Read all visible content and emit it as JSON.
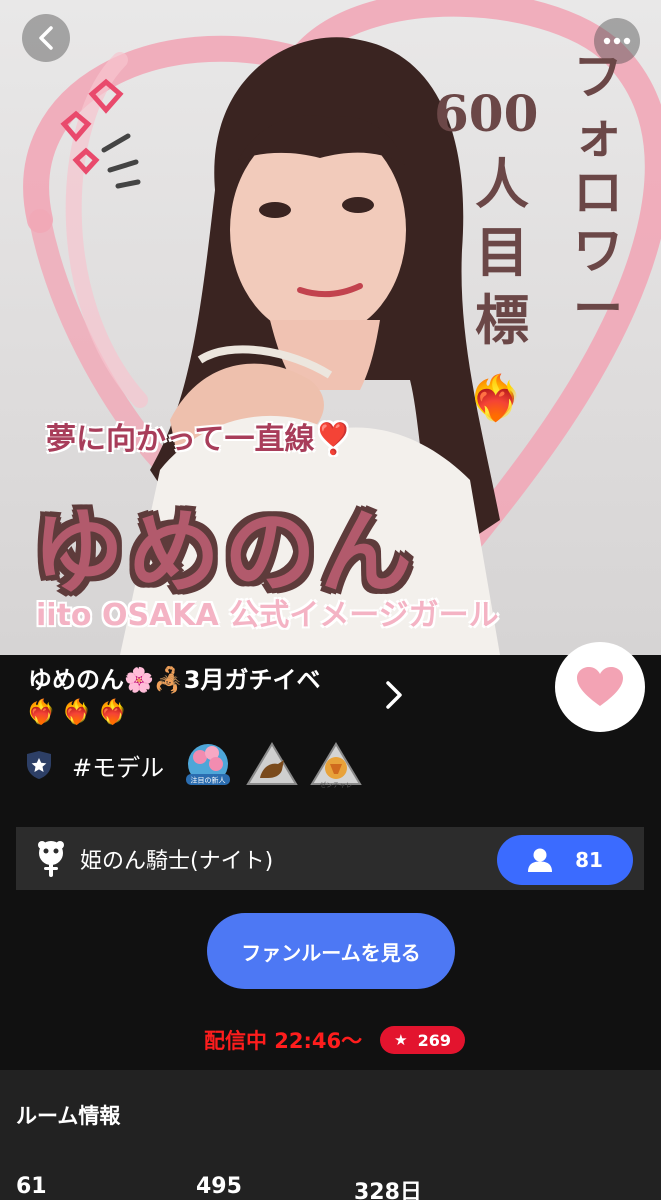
{
  "hero": {
    "vertical_follower": [
      "フ",
      "ォ",
      "ロ",
      "ワ",
      "ー"
    ],
    "follower_count": "600",
    "vertical_goal": [
      "人",
      "目",
      "標"
    ],
    "dream_line": "夢に向かって一直線❣️",
    "name_big": "ゆめのん",
    "brand_line": "iito OSAKA 公式イメージガール"
  },
  "profile": {
    "title": "ゆめのん🌸🦂3月ガチイベ",
    "title_emojis": "❤️‍🔥❤️‍🔥❤️‍🔥",
    "tag": "#モデル",
    "badges": [
      "注目の新人",
      "",
      "ゼンチャレ"
    ]
  },
  "fanclub": {
    "name": "姫のん騎士(ナイト)",
    "member_count": "81"
  },
  "fanroom_button": "ファンルームを見る",
  "live": {
    "text": "配信中 22:46〜",
    "star_count": "269"
  },
  "room_info": {
    "title": "ルーム情報",
    "stats": [
      "61",
      "495",
      "328日"
    ]
  },
  "colors": {
    "accent_blue": "#3b6bff",
    "button_blue": "#4d78f4",
    "live_red": "#ff1d1d",
    "heart_pink": "#f3a3b4"
  }
}
